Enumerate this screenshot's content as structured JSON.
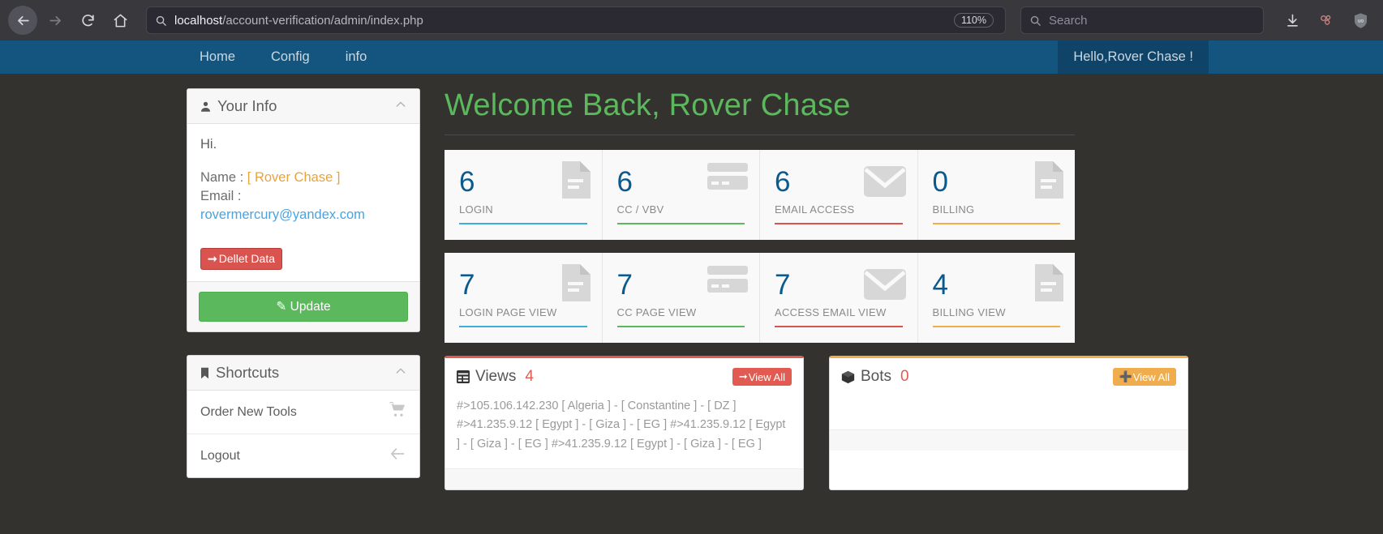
{
  "browser": {
    "back_icon": "back-arrow-icon",
    "forward_icon": "forward-arrow-icon",
    "reload_icon": "reload-icon",
    "home_icon": "home-icon",
    "url_host": "localhost",
    "url_path": "/account-verification/admin/index.php",
    "zoom_level": "110%",
    "search_placeholder": "Search",
    "search_icon": "search-icon",
    "url_search_icon": "search-icon",
    "downloads_icon": "download-icon",
    "containers_icon": "container-tabs-icon",
    "ublock_icon": "ublock-shield-icon",
    "overflow_icon": "chevron-double-right-icon",
    "menu_icon": "hamburger-menu-icon"
  },
  "navbar": {
    "items": [
      {
        "label": "Home"
      },
      {
        "label": "Config"
      },
      {
        "label": "info"
      }
    ],
    "greeting": "Hello,Rover Chase !",
    "bg_color": "#14557f",
    "greeting_bg_color": "#0f4468"
  },
  "sidebar": {
    "your_info": {
      "title": "Your Info",
      "icon": "user-icon",
      "collapse_icon": "chevron-up-icon",
      "hi_text": "Hi.",
      "name_label": "Name : ",
      "name_value": "[ Rover Chase ]",
      "name_color": "#e8a33d",
      "email_label": "Email :",
      "email_value": "rovermercury@yandex.com",
      "email_color": "#4aa3df",
      "delete_button": "Dellet Data",
      "delete_icon": "arrow-right-icon",
      "delete_color": "#d9534f",
      "update_button": "Update",
      "update_icon": "pencil-icon",
      "update_color": "#5cb85c"
    },
    "shortcuts": {
      "title": "Shortcuts",
      "icon": "bookmark-icon",
      "collapse_icon": "chevron-up-icon",
      "items": [
        {
          "label": "Order New Tools",
          "icon": "shopping-cart-icon"
        },
        {
          "label": "Logout",
          "icon": "arrow-left-icon"
        }
      ]
    }
  },
  "main": {
    "welcome_heading": "Welcome Back, Rover Chase",
    "welcome_color": "#5cb85c",
    "stats_row_1": [
      {
        "value": "6",
        "label": "LOGIN",
        "accent": "#3bafda",
        "icon": "file-document-icon"
      },
      {
        "value": "6",
        "label": "CC / VBV",
        "accent": "#5cb85c",
        "icon": "credit-card-icon"
      },
      {
        "value": "6",
        "label": "EMAIL ACCESS",
        "accent": "#d9534f",
        "icon": "envelope-icon"
      },
      {
        "value": "0",
        "label": "BILLING",
        "accent": "#f0ad4e",
        "icon": "file-document-icon"
      }
    ],
    "stats_row_2": [
      {
        "value": "7",
        "label": "LOGIN PAGE VIEW",
        "accent": "#3bafda",
        "icon": "file-document-icon"
      },
      {
        "value": "7",
        "label": "CC PAGE VIEW",
        "accent": "#5cb85c",
        "icon": "credit-card-icon"
      },
      {
        "value": "7",
        "label": "ACCESS EMAIL VIEW",
        "accent": "#d9534f",
        "icon": "envelope-icon"
      },
      {
        "value": "4",
        "label": "BILLING VIEW",
        "accent": "#f0ad4e",
        "icon": "file-document-icon"
      }
    ],
    "views_panel": {
      "title": "Views",
      "count": "4",
      "icon": "table-grid-icon",
      "view_all_label": "View All",
      "view_all_icon": "arrow-right-icon",
      "accent": "#e25b52",
      "entries": "#>105.106.142.230 [ Algeria ] - [ Constantine ] - [ DZ ] #>41.235.9.12 [ Egypt ] - [ Giza ] - [ EG ] #>41.235.9.12 [ Egypt ] - [ Giza ] - [ EG ] #>41.235.9.12 [ Egypt ] - [ Giza ] - [ EG ]"
    },
    "bots_panel": {
      "title": "Bots",
      "count": "0",
      "icon": "cube-icon",
      "view_all_label": "View All",
      "view_all_icon": "plus-icon",
      "accent": "#f0ad4e",
      "entries": ""
    }
  }
}
